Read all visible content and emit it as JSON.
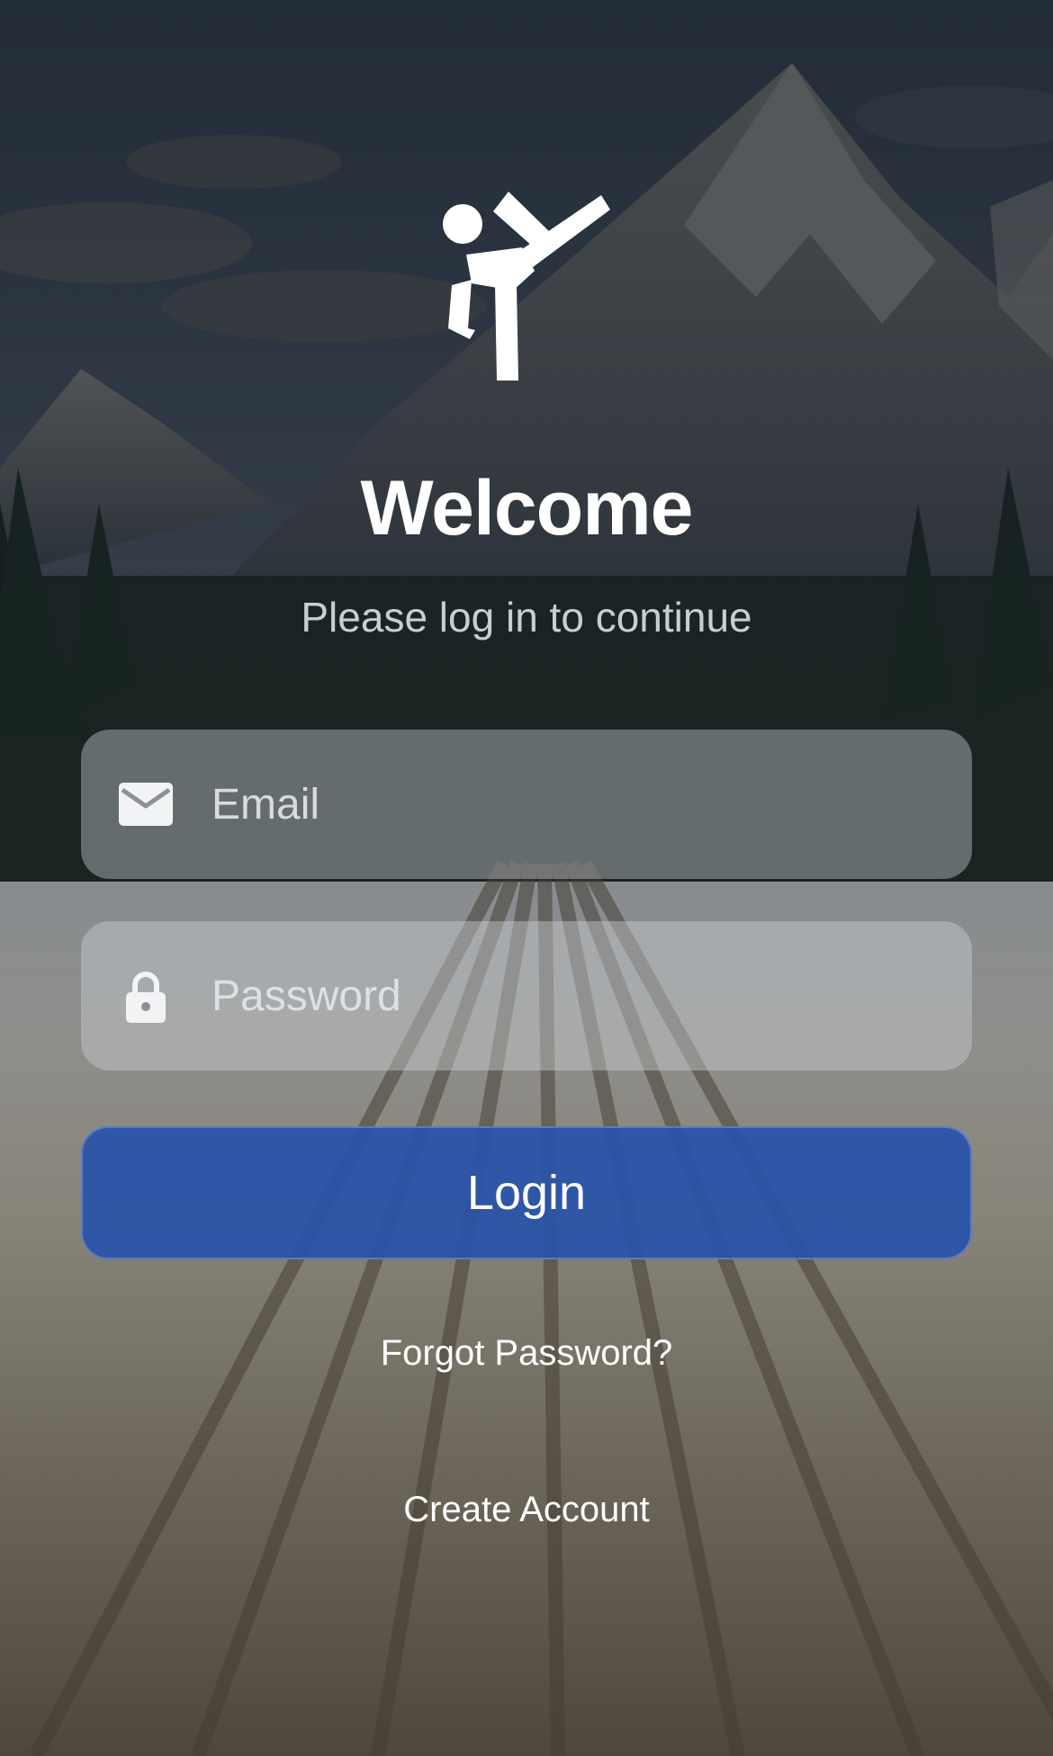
{
  "app": {
    "logo_icon": "martial-arts-kick-icon"
  },
  "header": {
    "title": "Welcome",
    "subtitle": "Please log in to continue"
  },
  "form": {
    "email": {
      "icon": "mail-icon",
      "placeholder": "Email",
      "value": ""
    },
    "password": {
      "icon": "lock-icon",
      "placeholder": "Password",
      "value": ""
    },
    "login_label": "Login"
  },
  "links": {
    "forgot_password": "Forgot Password?",
    "create_account": "Create Account"
  },
  "colors": {
    "primary_button": "#2852AA",
    "text": "#FFFFFF",
    "subtitle_text": "#C9CED6"
  }
}
